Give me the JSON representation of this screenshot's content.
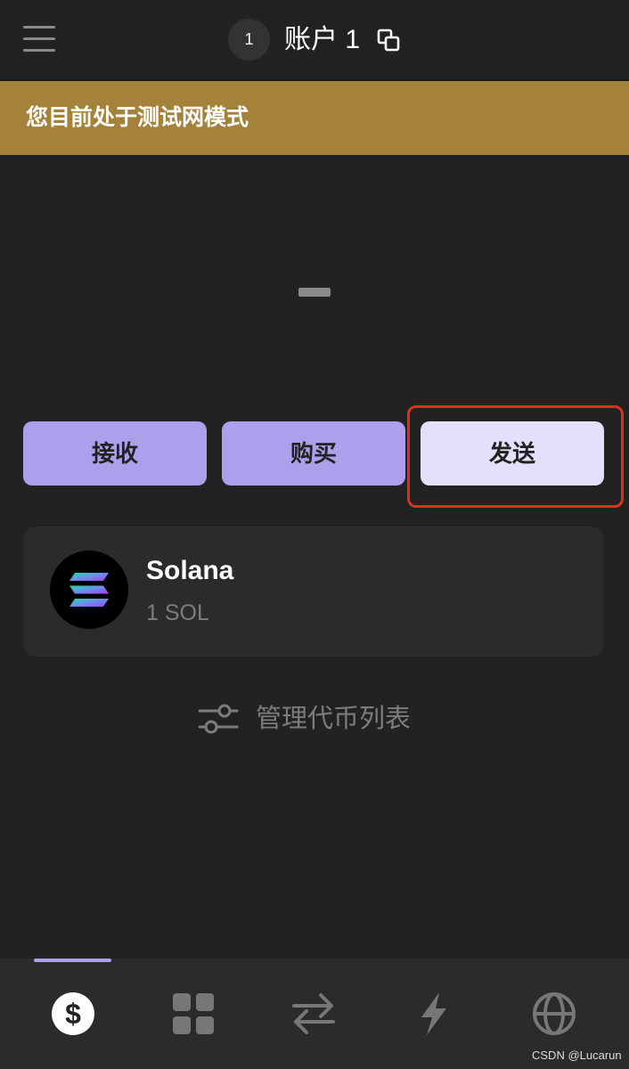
{
  "header": {
    "menu_icon": "hamburger-menu-icon",
    "account_number": "1",
    "account_name": "账户 1",
    "copy_icon": "copy-icon"
  },
  "banner": {
    "text": "您目前处于测试网模式",
    "color": "#a4823a"
  },
  "balance": {
    "display": "—"
  },
  "actions": {
    "receive_label": "接收",
    "buy_label": "购买",
    "send_label": "发送",
    "accent_color": "#ac9fec",
    "highlight_color": "#d9321e"
  },
  "tokens": [
    {
      "name": "Solana",
      "amount": "1 SOL",
      "icon": "solana-logo-icon"
    }
  ],
  "manage_tokens": {
    "label": "管理代币列表",
    "icon": "sliders-icon"
  },
  "tabbar": {
    "active_index": 0,
    "tabs": [
      {
        "name": "tokens",
        "icon": "dollar-icon"
      },
      {
        "name": "collectibles",
        "icon": "grid-icon"
      },
      {
        "name": "swap",
        "icon": "swap-arrows-icon"
      },
      {
        "name": "activity",
        "icon": "lightning-icon"
      },
      {
        "name": "explore",
        "icon": "globe-icon"
      }
    ]
  },
  "watermark": "CSDN @Lucarun"
}
